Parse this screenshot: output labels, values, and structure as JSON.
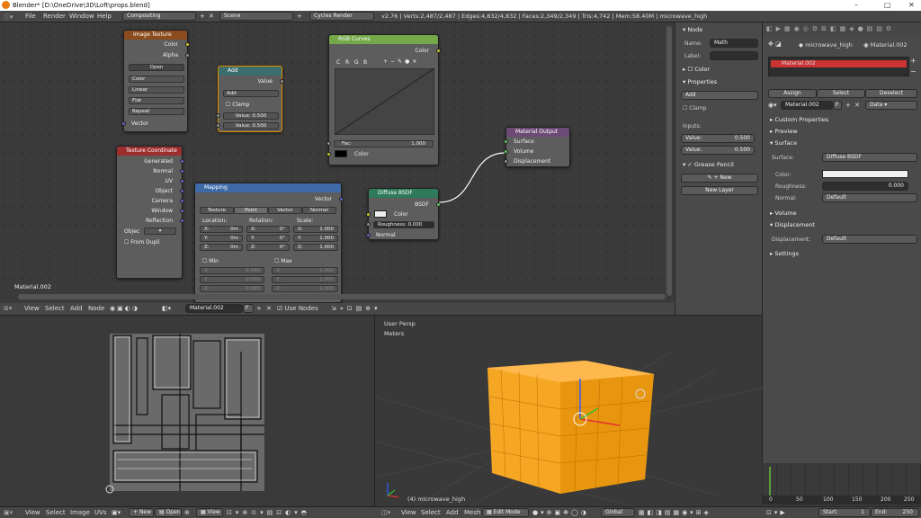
{
  "window": {
    "title": "Blender* [D:\\OneDrive\\3D\\Loft\\props.blend]"
  },
  "menu": {
    "items": [
      "File",
      "Render",
      "Window",
      "Help"
    ],
    "screen": "Compositing",
    "scene": "Scene",
    "engine": "Cycles Render",
    "stats": "v2.76 | Verts:2,487/2,487 | Edges:4,832/4,832 | Faces:2,349/2,349 | Tris:4,742 | Mem:58.40M | microwave_high"
  },
  "nodes": {
    "image_texture": {
      "title": "Image Texture",
      "out1": "Color",
      "out2": "Alpha",
      "open": "Open",
      "opt1": "Color",
      "opt2": "Linear",
      "opt3": "Flat",
      "opt4": "Repeat",
      "in1": "Vector"
    },
    "add": {
      "title": "Add",
      "out": "Value",
      "mode": "Add",
      "clamp": "Clamp",
      "v1": "Value:",
      "v1n": "0.500",
      "v2": "Value:",
      "v2n": "0.500"
    },
    "rgb_curves": {
      "title": "RGB Curves",
      "out": "Color",
      "c": "C",
      "r": "R",
      "g": "G",
      "b": "B",
      "fac": "Fac:",
      "facv": "1.000",
      "in": "Color"
    },
    "material_output": {
      "title": "Material Output",
      "i1": "Surface",
      "i2": "Volume",
      "i3": "Displacement"
    },
    "tex_coord": {
      "title": "Texture Coordinate",
      "o1": "Generated",
      "o2": "Normal",
      "o3": "UV",
      "o4": "Object",
      "o5": "Camera",
      "o6": "Window",
      "o7": "Reflection",
      "obj": "Objec",
      "dupli": "From Dupli"
    },
    "mapping": {
      "title": "Mapping",
      "out": "Vector",
      "t1": "Texture",
      "t2": "Point",
      "t3": "Vector",
      "t4": "Normal",
      "loc": "Location:",
      "rot": "Rotation:",
      "scl": "Scale:",
      "x": "X:",
      "y": "Y:",
      "z": "Z:",
      "locv": "0m",
      "rotv": "0°",
      "sclv": "1.000",
      "min": "Min",
      "max": "Max",
      "minv": "0.000",
      "maxv": "1.000"
    },
    "diffuse": {
      "title": "Diffuse BSDF",
      "out": "BSDF",
      "color": "Color",
      "rough": "Roughness:",
      "roughv": "0.000",
      "normal": "Normal"
    },
    "material_label": "Material.002"
  },
  "node_header": {
    "items": [
      "View",
      "Select",
      "Add",
      "Node"
    ],
    "material": "Material.002",
    "f": "F",
    "use_nodes": "Use Nodes"
  },
  "npanel": {
    "node": "Node",
    "name_l": "Name:",
    "name_v": "Math",
    "label_l": "Label:",
    "color": "Color",
    "properties": "Properties",
    "add": "Add",
    "clamp": "Clamp",
    "inputs": "Inputs:",
    "v1": "Value:",
    "v1n": "0.500",
    "v2": "Value:",
    "v2n": "0.500",
    "grease": "Grease Pencil",
    "new": "New",
    "new_layer": "New Layer"
  },
  "props": {
    "obj": "microwave_high",
    "mat": "Material.002",
    "slot": "Material.002",
    "assign": "Assign",
    "select": "Select",
    "deselect": "Deselect",
    "matfield": "Material.002",
    "f": "F",
    "data": "Data",
    "custom": "Custom Properties",
    "preview": "Preview",
    "surface": "Surface",
    "surface_l": "Surface:",
    "surface_v": "Diffuse BSDF",
    "color_l": "Color:",
    "rough_l": "Roughness:",
    "rough_v": "0.000",
    "normal_l": "Normal:",
    "normal_v": "Default",
    "volume": "Volume",
    "displacement": "Displacement",
    "disp_l": "Displacement:",
    "disp_v": "Default",
    "settings": "Settings"
  },
  "timeline": {
    "ticks": [
      "0",
      "50",
      "100",
      "150",
      "200",
      "250"
    ]
  },
  "viewport": {
    "persp": "User Persp",
    "units": "Meters",
    "object": "(4) microwave_high"
  },
  "bottom": {
    "uv": [
      "View",
      "Select",
      "Image",
      "UVs"
    ],
    "new": "New",
    "open": "Open",
    "view": "View",
    "v3d": [
      "View",
      "Select",
      "Add",
      "Mesh"
    ],
    "mode": "Edit Mode",
    "global": "Global",
    "start_l": "Start:",
    "start_v": "1",
    "end_l": "End:",
    "end_v": "250"
  },
  "colors": {
    "accent": "#f5a623",
    "selection": "#ff8c00",
    "header_green": "#74a848"
  }
}
